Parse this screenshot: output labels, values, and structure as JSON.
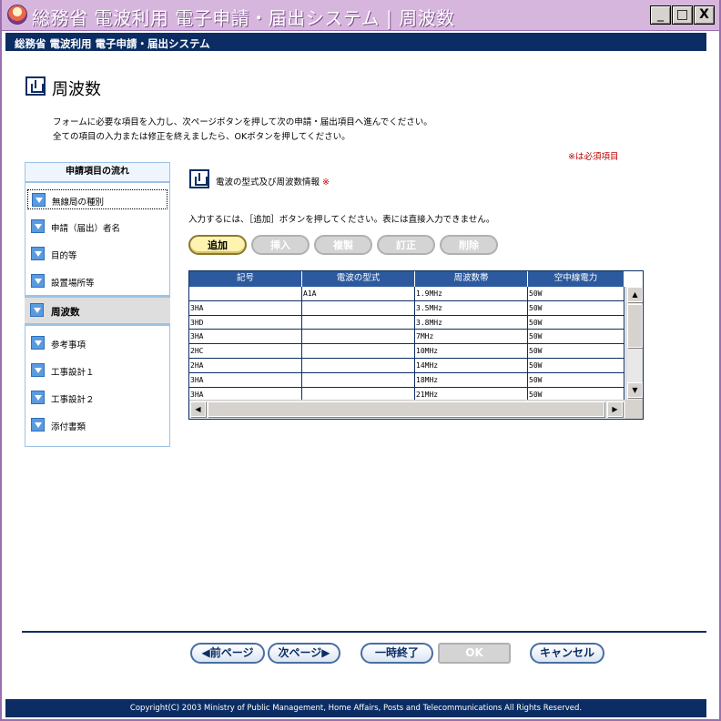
{
  "window": {
    "title": "総務省 電波利用 電子申請・届出システム | 周波数",
    "min_glyph": "_",
    "max_glyph": "□",
    "close_glyph": "X"
  },
  "header": {
    "system_name": "総務省 電波利用 電子申請・届出システム"
  },
  "page": {
    "title": "周波数",
    "instruction_line1": "フォームに必要な項目を入力し、次ページボタンを押して次の申請・届出項目へ進んでください。",
    "instruction_line2": "全ての項目の入力または修正を終えましたら、OKボタンを押してください。",
    "required_note": "※は必須項目"
  },
  "sidebar": {
    "heading": "申請項目の流れ",
    "items": [
      {
        "label": "無線局の種別"
      },
      {
        "label": "申請（届出）者名"
      },
      {
        "label": "目的等"
      },
      {
        "label": "設置場所等"
      },
      {
        "label": "周波数",
        "current": true
      },
      {
        "label": "参考事項"
      },
      {
        "label": "工事設計１"
      },
      {
        "label": "工事設計２"
      },
      {
        "label": "添付書類"
      }
    ]
  },
  "section": {
    "title": "電波の型式及び周波数情報",
    "required_mark": "※",
    "instruction": "入力するには、［追加］ボタンを押してください。表には直接入力できません。",
    "buttons": {
      "add": "追加",
      "insert": "挿入",
      "copy": "複製",
      "correct": "訂正",
      "delete": "削除"
    }
  },
  "table": {
    "columns": [
      "記号",
      "電波の型式",
      "周波数帯",
      "空中線電力"
    ],
    "rows": [
      [
        "",
        "A1A",
        "1.9MHz",
        "50W"
      ],
      [
        "3HA",
        "",
        "3.5MHz",
        "50W"
      ],
      [
        "3HD",
        "",
        "3.8MHz",
        "50W"
      ],
      [
        "3HA",
        "",
        "7MHz",
        "50W"
      ],
      [
        "2HC",
        "",
        "10MHz",
        "50W"
      ],
      [
        "2HA",
        "",
        "14MHz",
        "50W"
      ],
      [
        "3HA",
        "",
        "18MHz",
        "50W"
      ],
      [
        "3HA",
        "",
        "21MHz",
        "50W"
      ]
    ]
  },
  "nav": {
    "prev": "◀前ページ",
    "next": "次ページ▶",
    "suspend": "一時終了",
    "ok": "OK",
    "cancel": "キャンセル"
  },
  "footer": {
    "copyright": "Copyright(C) 2003 Ministry of Public Management, Home Affairs, Posts and Telecommunications All Rights Reserved."
  },
  "colors": {
    "navy": "#0b2d63",
    "title_bar": "#d7b6dd",
    "required_red": "#c00000",
    "active_button": "#fff3b0"
  }
}
